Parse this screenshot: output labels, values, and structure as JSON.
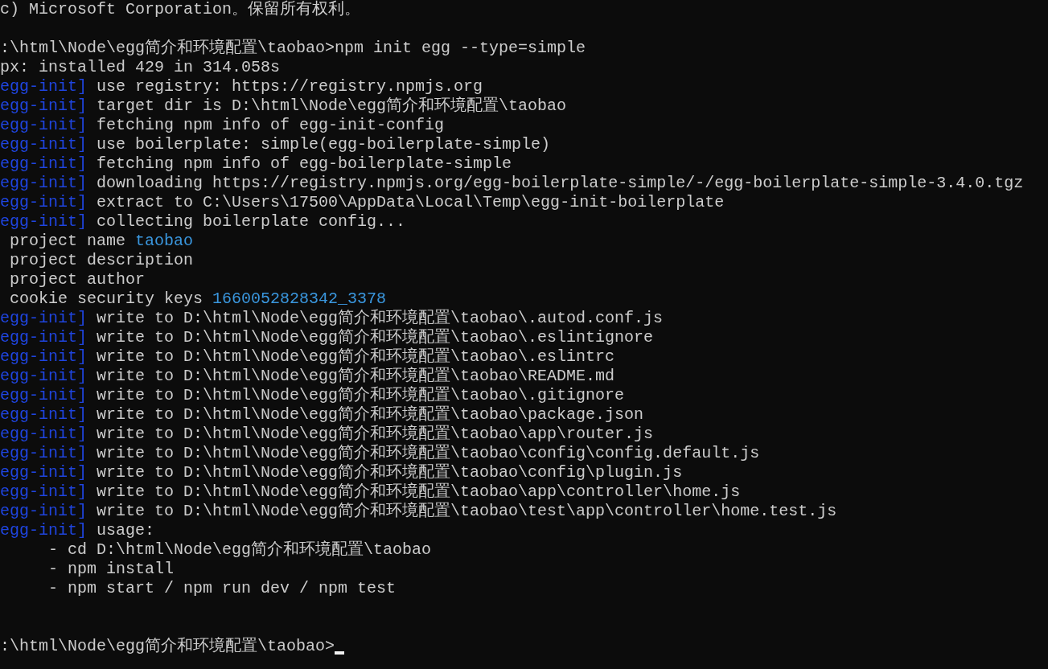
{
  "terminal": {
    "lines": [
      {
        "kind": "plain",
        "text": "c) Microsoft Corporation。保留所有权利。"
      },
      {
        "kind": "blank"
      },
      {
        "kind": "prompt",
        "path": ":\\html\\Node\\egg简介和环境配置\\taobao>",
        "command": "npm init egg --type=simple",
        "cursor": false
      },
      {
        "kind": "plain",
        "text": "px: installed 429 in 314.058s"
      },
      {
        "kind": "log",
        "tag": "egg-init]",
        "text": "use registry: https://registry.npmjs.org"
      },
      {
        "kind": "log",
        "tag": "egg-init]",
        "text": "target dir is D:\\html\\Node\\egg简介和环境配置\\taobao"
      },
      {
        "kind": "log",
        "tag": "egg-init]",
        "text": "fetching npm info of egg-init-config"
      },
      {
        "kind": "log",
        "tag": "egg-init]",
        "text": "use boilerplate: simple(egg-boilerplate-simple)"
      },
      {
        "kind": "log",
        "tag": "egg-init]",
        "text": "fetching npm info of egg-boilerplate-simple"
      },
      {
        "kind": "log",
        "tag": "egg-init]",
        "text": "downloading https://registry.npmjs.org/egg-boilerplate-simple/-/egg-boilerplate-simple-3.4.0.tgz"
      },
      {
        "kind": "log",
        "tag": "egg-init]",
        "text": "extract to C:\\Users\\17500\\AppData\\Local\\Temp\\egg-init-boilerplate"
      },
      {
        "kind": "log",
        "tag": "egg-init]",
        "text": "collecting boilerplate config..."
      },
      {
        "kind": "answer",
        "label": "project name",
        "value": "taobao"
      },
      {
        "kind": "answer",
        "label": "project description"
      },
      {
        "kind": "answer",
        "label": "project author"
      },
      {
        "kind": "answer",
        "label": "cookie security keys",
        "value": "1660052828342_3378"
      },
      {
        "kind": "log",
        "tag": "egg-init]",
        "text": "write to D:\\html\\Node\\egg简介和环境配置\\taobao\\.autod.conf.js"
      },
      {
        "kind": "log",
        "tag": "egg-init]",
        "text": "write to D:\\html\\Node\\egg简介和环境配置\\taobao\\.eslintignore"
      },
      {
        "kind": "log",
        "tag": "egg-init]",
        "text": "write to D:\\html\\Node\\egg简介和环境配置\\taobao\\.eslintrc"
      },
      {
        "kind": "log",
        "tag": "egg-init]",
        "text": "write to D:\\html\\Node\\egg简介和环境配置\\taobao\\README.md"
      },
      {
        "kind": "log",
        "tag": "egg-init]",
        "text": "write to D:\\html\\Node\\egg简介和环境配置\\taobao\\.gitignore"
      },
      {
        "kind": "log",
        "tag": "egg-init]",
        "text": "write to D:\\html\\Node\\egg简介和环境配置\\taobao\\package.json"
      },
      {
        "kind": "log",
        "tag": "egg-init]",
        "text": "write to D:\\html\\Node\\egg简介和环境配置\\taobao\\app\\router.js"
      },
      {
        "kind": "log",
        "tag": "egg-init]",
        "text": "write to D:\\html\\Node\\egg简介和环境配置\\taobao\\config\\config.default.js"
      },
      {
        "kind": "log",
        "tag": "egg-init]",
        "text": "write to D:\\html\\Node\\egg简介和环境配置\\taobao\\config\\plugin.js"
      },
      {
        "kind": "log",
        "tag": "egg-init]",
        "text": "write to D:\\html\\Node\\egg简介和环境配置\\taobao\\app\\controller\\home.js"
      },
      {
        "kind": "log",
        "tag": "egg-init]",
        "text": "write to D:\\html\\Node\\egg简介和环境配置\\taobao\\test\\app\\controller\\home.test.js"
      },
      {
        "kind": "log",
        "tag": "egg-init]",
        "text": "usage:"
      },
      {
        "kind": "item",
        "text": "- cd D:\\html\\Node\\egg简介和环境配置\\taobao"
      },
      {
        "kind": "item",
        "text": "- npm install"
      },
      {
        "kind": "item",
        "text": "- npm start / npm run dev / npm test"
      },
      {
        "kind": "blank"
      },
      {
        "kind": "blank"
      },
      {
        "kind": "prompt",
        "path": ":\\html\\Node\\egg简介和环境配置\\taobao>",
        "cursor": true
      }
    ]
  }
}
